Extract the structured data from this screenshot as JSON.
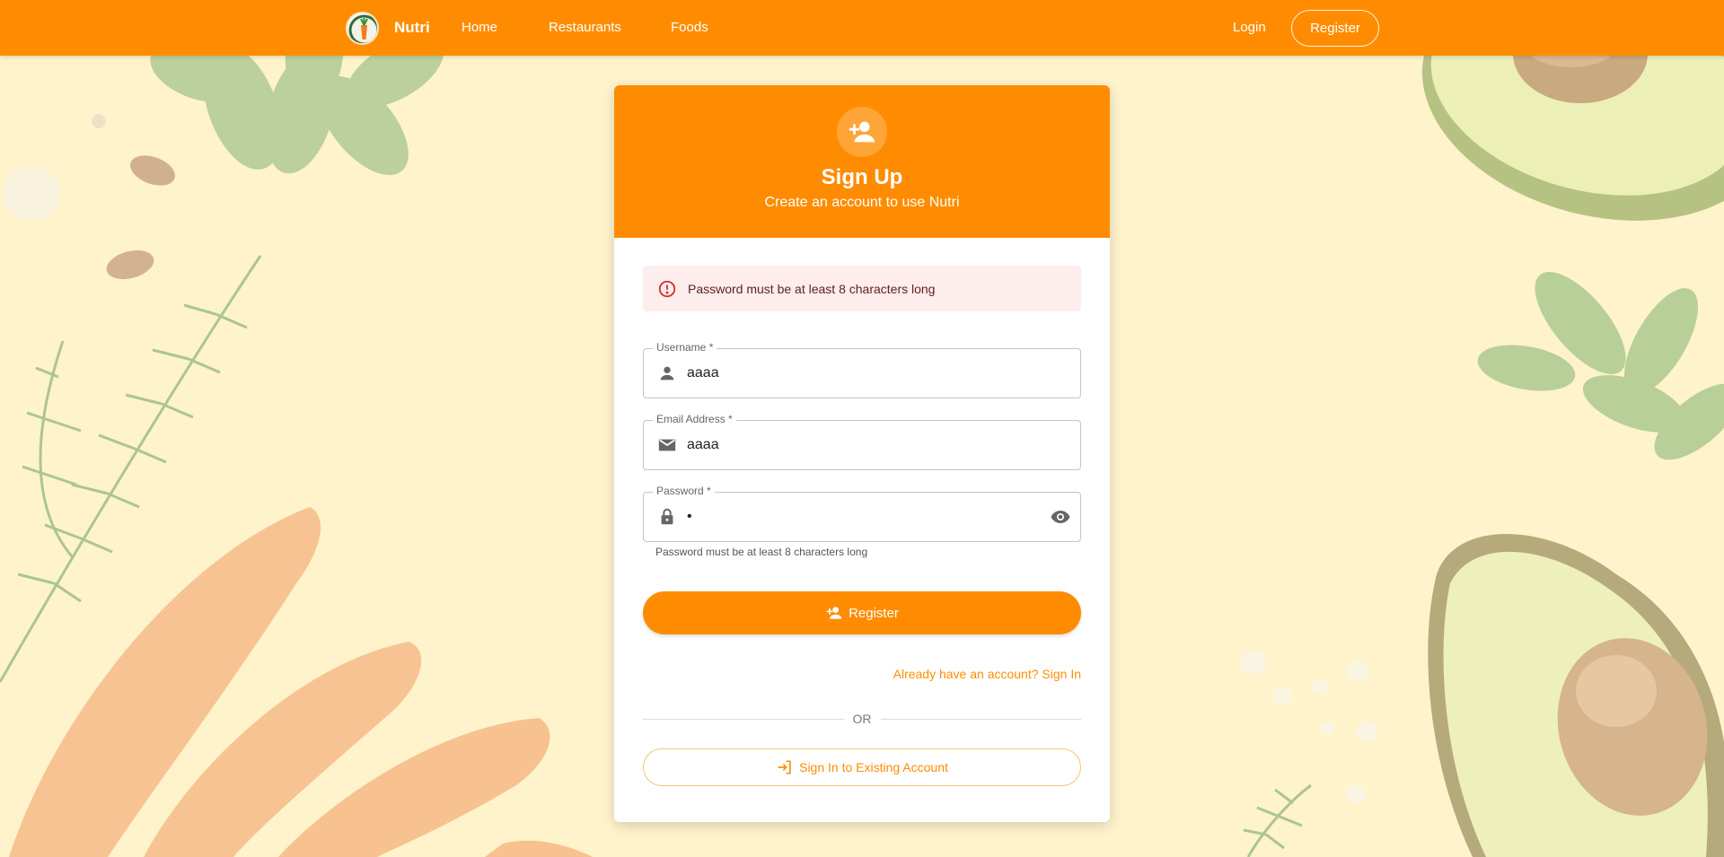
{
  "navbar": {
    "brand": "Nutri",
    "links": [
      {
        "label": "Home"
      },
      {
        "label": "Restaurants"
      },
      {
        "label": "Foods"
      }
    ],
    "login": "Login",
    "register": "Register",
    "background_color": "#ff8c00"
  },
  "card": {
    "title": "Sign Up",
    "subtitle": "Create an account to use Nutri",
    "header_icon": "person-add-icon",
    "alert": {
      "message": "Password must be at least 8 characters long",
      "icon": "error-outline-icon"
    },
    "fields": {
      "username": {
        "label": "Username *",
        "value": "aaaa",
        "icon": "person-icon"
      },
      "email": {
        "label": "Email Address *",
        "value": "aaaa",
        "icon": "mail-icon"
      },
      "password": {
        "label": "Password *",
        "value": "•",
        "icon": "lock-icon",
        "toggle_icon": "visibility-icon",
        "helper": "Password must be at least 8 characters long"
      }
    },
    "register_button": "Register",
    "signin_link": "Already have an account? Sign In",
    "divider": "OR",
    "signin_button": "Sign In to Existing Account",
    "accent_color": "#ff8c00"
  }
}
